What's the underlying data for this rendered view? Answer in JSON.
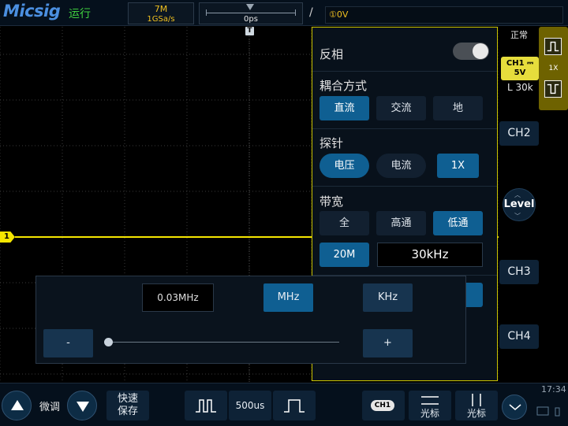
{
  "top_bar": {
    "logo": "Micsig",
    "run_status": "运行",
    "memory_depth": "7M",
    "sample_rate": "1GSa/s",
    "horizontal_position": "0ps",
    "trigger_level": "①0V"
  },
  "waveform": {
    "trigger_position_marker": "T",
    "ch1_marker": "1"
  },
  "channel_menu": {
    "invert": {
      "label": "反相",
      "enabled": false
    },
    "coupling": {
      "title": "耦合方式",
      "options": [
        "直流",
        "交流",
        "地"
      ],
      "selected": "直流"
    },
    "probe": {
      "title": "探针",
      "options": [
        "电压",
        "电流"
      ],
      "selected": "电压",
      "ratio": "1X"
    },
    "bandwidth": {
      "title": "带宽",
      "options": [
        "全",
        "高通",
        "低通"
      ],
      "selected": "低通",
      "limit_button": "20M",
      "value": "30kHz"
    }
  },
  "keypad": {
    "display": "0.03MHz",
    "unit_mhz": "MHz",
    "unit_khz": "KHz",
    "minus": "-",
    "plus": "+"
  },
  "right_panel": {
    "trigger_mode": "正常",
    "ch1_label": "CH1",
    "ch1_coupling_symbol": "⎓",
    "ch1_scale": "5V",
    "ch1_bandwidth": "L 30k",
    "trigger_probe_ratio": "1X",
    "ch2": "CH2",
    "level": "Level",
    "ch3": "CH3",
    "ch4": "CH4"
  },
  "bottom_bar": {
    "fine_adjust": "微调",
    "quick_save_line1": "快速",
    "quick_save_line2": "保存",
    "timebase": "500us",
    "ch1_badge": "CH1",
    "cursor1": "光标",
    "cursor2": "光标",
    "time": "17:34"
  },
  "colors": {
    "ch1": "#f5e600",
    "accent": "#0f5f92",
    "menu_border": "#c9c300"
  }
}
